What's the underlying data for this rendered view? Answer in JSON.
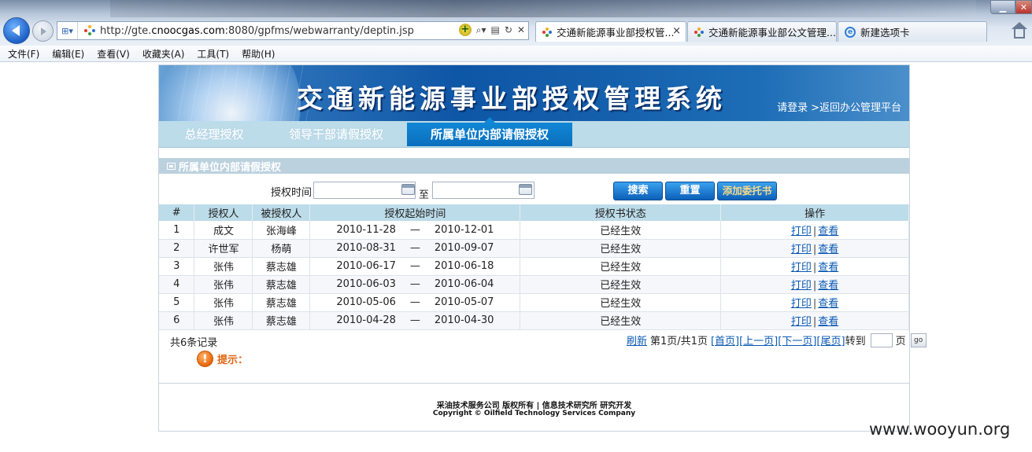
{
  "browser": {
    "url_prefix": "http://gte.",
    "url_domain": "cnoocgas.com",
    "url_suffix": ":8080/gpfms/webwarranty/deptin.jsp",
    "tabs": [
      {
        "title": "交通新能源事业部授权管...",
        "close": "×"
      },
      {
        "title": "交通新能源事业部公文管理..."
      },
      {
        "title": "新建选项卡"
      }
    ],
    "menu": [
      "文件(F)",
      "编辑(E)",
      "查看(V)",
      "收藏夹(A)",
      "工具(T)",
      "帮助(H)"
    ]
  },
  "banner": {
    "title": "交通新能源事业部授权管理系统",
    "login": "请登录",
    "back": ">返回办公管理平台"
  },
  "tabs": [
    "总经理授权",
    "领导干部请假授权",
    "所属单位内部请假授权"
  ],
  "section": {
    "title": "所属单位内部请假授权"
  },
  "search": {
    "time_label": "授权时间",
    "to_label": "至",
    "start_value": "",
    "end_value": "",
    "search_btn": "搜索",
    "reset_btn": "重置",
    "add_btn": "添加委托书"
  },
  "table": {
    "headers": [
      "#",
      "授权人",
      "被授权人",
      "授权起始时间",
      "授权书状态",
      "操作"
    ],
    "rows": [
      {
        "num": "1",
        "grantor": "成文",
        "grantee": "张海峰",
        "start": "2010-11-28",
        "end": "2010-12-01",
        "status": "已经生效"
      },
      {
        "num": "2",
        "grantor": "许世军",
        "grantee": "杨萌",
        "start": "2010-08-31",
        "end": "2010-09-07",
        "status": "已经生效"
      },
      {
        "num": "3",
        "grantor": "张伟",
        "grantee": "蔡志雄",
        "start": "2010-06-17",
        "end": "2010-06-18",
        "status": "已经生效"
      },
      {
        "num": "4",
        "grantor": "张伟",
        "grantee": "蔡志雄",
        "start": "2010-06-03",
        "end": "2010-06-04",
        "status": "已经生效"
      },
      {
        "num": "5",
        "grantor": "张伟",
        "grantee": "蔡志雄",
        "start": "2010-05-06",
        "end": "2010-05-07",
        "status": "已经生效"
      },
      {
        "num": "6",
        "grantor": "张伟",
        "grantee": "蔡志雄",
        "start": "2010-04-28",
        "end": "2010-04-30",
        "status": "已经生效"
      }
    ],
    "dash": "—",
    "print_label": "打印",
    "view_label": "查看",
    "op_sep": "|"
  },
  "pager": {
    "records": "共6条记录",
    "refresh": "刷新",
    "info": "第1页/共1页",
    "first": "[首页]",
    "prev": "[上一页]",
    "next": "[下一页]",
    "last": "[尾页]",
    "goto": "转到",
    "page_unit": "页",
    "go": "go"
  },
  "tip": {
    "icon": "!",
    "text": "提示："
  },
  "footer": {
    "line1": "采油技术服务公司 版权所有 | 信息技术研究所 研究开发",
    "line2": "Copyright © Oilfield Technology Services Company"
  },
  "watermark": "www.wooyun.org"
}
